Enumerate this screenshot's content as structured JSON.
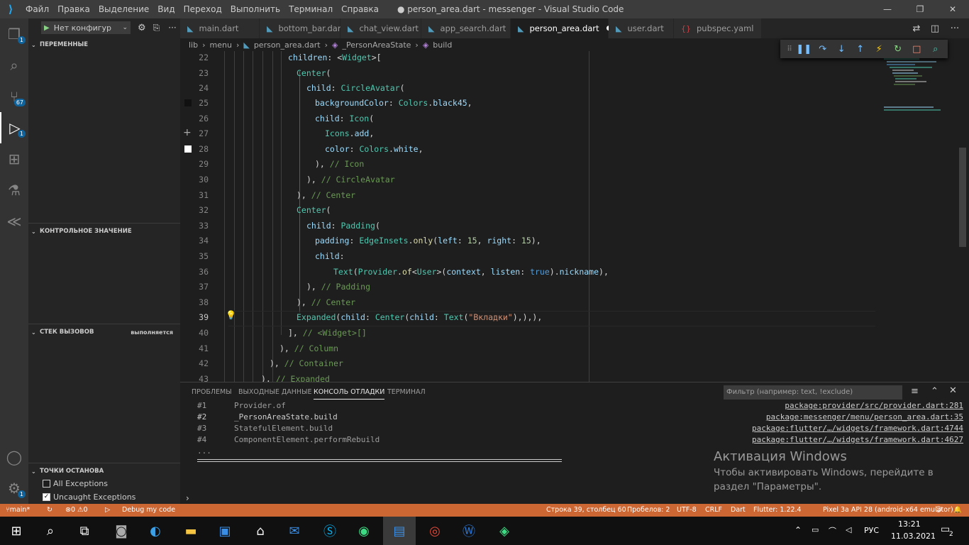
{
  "titlebar": {
    "menu": [
      "Файл",
      "Правка",
      "Выделение",
      "Вид",
      "Переход",
      "Выполнить",
      "Терминал",
      "Справка"
    ],
    "title": "● person_area.dart - messenger - Visual Studio Code"
  },
  "activity": {
    "explorer_badge": "1",
    "scm_badge": "67",
    "debug_badge": "1",
    "manage_badge": "1"
  },
  "sidebar": {
    "config": "Нет конфигур",
    "variables": "ПЕРЕМЕННЫЕ",
    "watch": "КОНТРОЛЬНОЕ ЗНАЧЕНИЕ",
    "callstack": "СТЕК ВЫЗОВОВ",
    "callstack_status": "выполняется",
    "breakpoints": "ТОЧКИ ОСТАНОВА",
    "bp_all": "All Exceptions",
    "bp_uncaught": "Uncaught Exceptions"
  },
  "tabs": [
    "main.dart",
    "bottom_bar.dart",
    "chat_view.dart",
    "app_search.dart",
    "person_area.dart",
    "user.dart",
    "pubspec.yaml"
  ],
  "breadcrumb": {
    "a": "lib",
    "b": "menu",
    "c": "person_area.dart",
    "d": "_PersonAreaState",
    "e": "build"
  },
  "editor": {
    "lines": [
      "22",
      "23",
      "24",
      "25",
      "26",
      "27",
      "28",
      "29",
      "30",
      "31",
      "32",
      "33",
      "34",
      "35",
      "36",
      "37",
      "38",
      "39",
      "40",
      "41",
      "42",
      "43"
    ]
  },
  "panel": {
    "tabs": [
      "ПРОБЛЕМЫ",
      "ВЫХОДНЫЕ ДАННЫЕ",
      "КОНСОЛЬ ОТЛАДКИ",
      "ТЕРМИНАЛ"
    ],
    "filter": "Фильтр (например: text, !exclude)",
    "stack": [
      {
        "n": "#1",
        "f": "Provider.of",
        "l": "package:provider/src/provider.dart:281"
      },
      {
        "n": "#2",
        "f": "_PersonAreaState.build",
        "l": "package:messenger/menu/person_area.dart:35"
      },
      {
        "n": "#3",
        "f": "StatefulElement.build",
        "l": "package:flutter/…/widgets/framework.dart:4744"
      },
      {
        "n": "#4",
        "f": "ComponentElement.performRebuild",
        "l": "package:flutter/…/widgets/framework.dart:4627"
      }
    ],
    "ellipsis": "...",
    "activate_title": "Активация Windows",
    "activate_l1": "Чтобы активировать Windows, перейдите в",
    "activate_l2": "раздел \"Параметры\"."
  },
  "status": {
    "branch": "main*",
    "errors": "⊗0 ⚠0",
    "debug": "Debug my code",
    "pos": "Строка 39, столбец 60",
    "spaces": "Пробелов: 2",
    "enc": "UTF-8",
    "eol": "CRLF",
    "lang": "Dart",
    "flutter": "Flutter: 1.22.4",
    "device": "Pixel 3a API 28 (android-x64 emulator)"
  },
  "taskbar": {
    "lang": "РУС",
    "time": "13:21",
    "date": "11.03.2021",
    "notif": "2"
  }
}
